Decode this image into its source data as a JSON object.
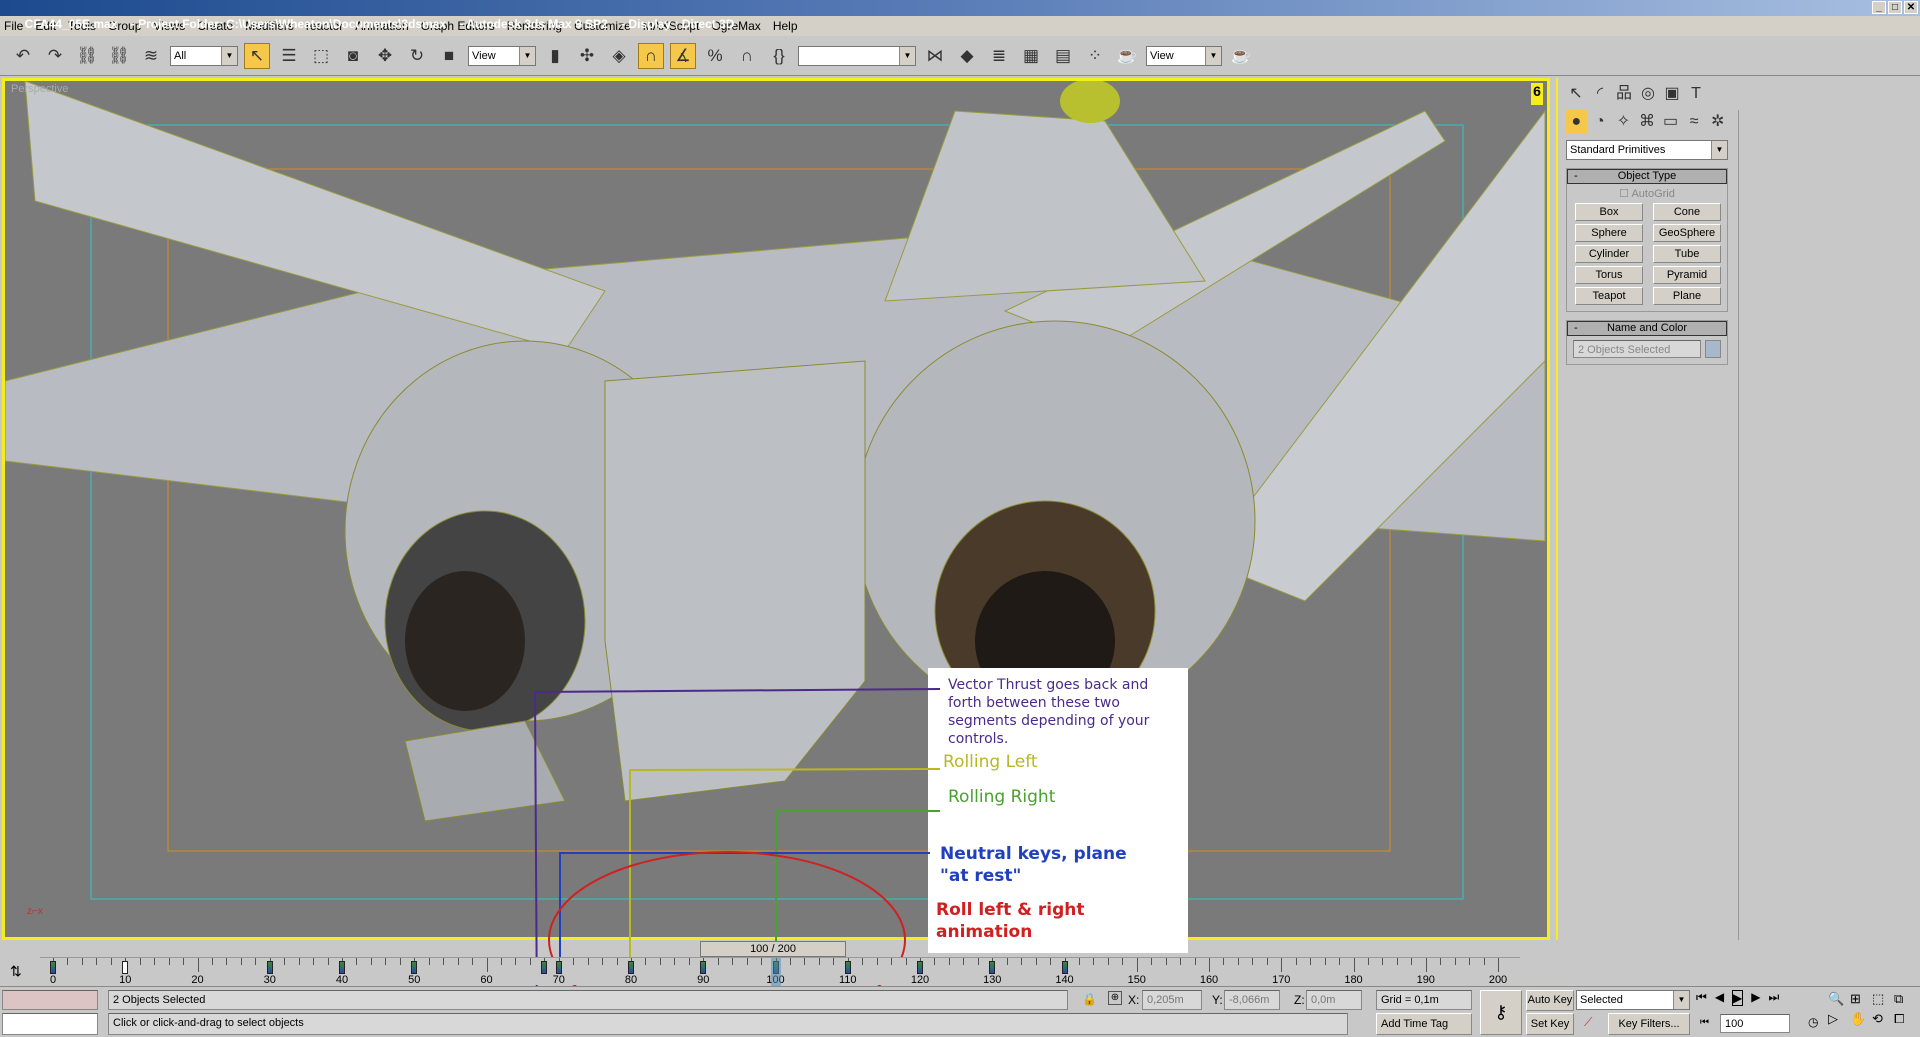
{
  "window": {
    "title": "CFA44_05E.max    - Project Folder: C:\\Users\\Wheaton\\Documents\\3dsmax    - Autodesk 3ds Max 9 SP2    - Display : Direct 3D"
  },
  "menu": [
    "File",
    "Edit",
    "Tools",
    "Group",
    "Views",
    "Create",
    "Modifiers",
    "reactor",
    "Animation",
    "Graph Editors",
    "Rendering",
    "Customize",
    "MAXScript",
    "OgreMax",
    "Help"
  ],
  "toolbar": {
    "selection_filter": "All",
    "ref_coord": "View",
    "named_selection": "",
    "render_view": "View"
  },
  "viewport": {
    "label": "Perspective",
    "border_color": "#f5ee1c"
  },
  "command_panel": {
    "category": "Standard Primitives",
    "object_type_title": "Object Type",
    "autogrid": "AutoGrid",
    "buttons": [
      "Box",
      "Cone",
      "Sphere",
      "GeoSphere",
      "Cylinder",
      "Tube",
      "Torus",
      "Pyramid",
      "Teapot",
      "Plane"
    ],
    "name_color_title": "Name and Color",
    "name_value": "2 Objects Selected"
  },
  "annotations": {
    "vector_thrust": "Vector Thrust goes back and forth between these two segments depending of your controls.",
    "rolling_left": "Rolling Left",
    "rolling_right": "Rolling Right",
    "neutral_1": "Neutral keys, plane",
    "neutral_2": "\"at rest\"",
    "roll_1": "Roll left & right",
    "roll_2": "animation",
    "colors": {
      "vector": "#4b2a8c",
      "left": "#b8b820",
      "right": "#4aa030",
      "neutral": "#2040c0",
      "roll": "#d02020"
    }
  },
  "timeline": {
    "slider": "100 / 200",
    "current": 100,
    "total": 200,
    "labels": [
      "0",
      "10",
      "20",
      "30",
      "40",
      "50",
      "60",
      "70",
      "80",
      "90",
      "100",
      "110",
      "120",
      "130",
      "140",
      "150",
      "160",
      "170",
      "180",
      "190",
      "200"
    ],
    "keys": [
      0,
      10,
      30,
      40,
      50,
      68,
      70,
      80,
      90,
      100,
      110,
      120,
      130,
      140
    ]
  },
  "status": {
    "selection": "2 Objects Selected",
    "prompt": "Click or click-and-drag to select objects",
    "x": "0,205m",
    "y": "-8,066m",
    "z": "0,0m",
    "x_label": "X:",
    "y_label": "Y:",
    "z_label": "Z:",
    "grid": "Grid = 0,1m",
    "add_time_tag": "Add Time Tag",
    "auto_key": "Auto Key",
    "set_key": "Set Key",
    "key_mode": "Selected",
    "key_filters": "Key Filters...",
    "frame": "100"
  }
}
